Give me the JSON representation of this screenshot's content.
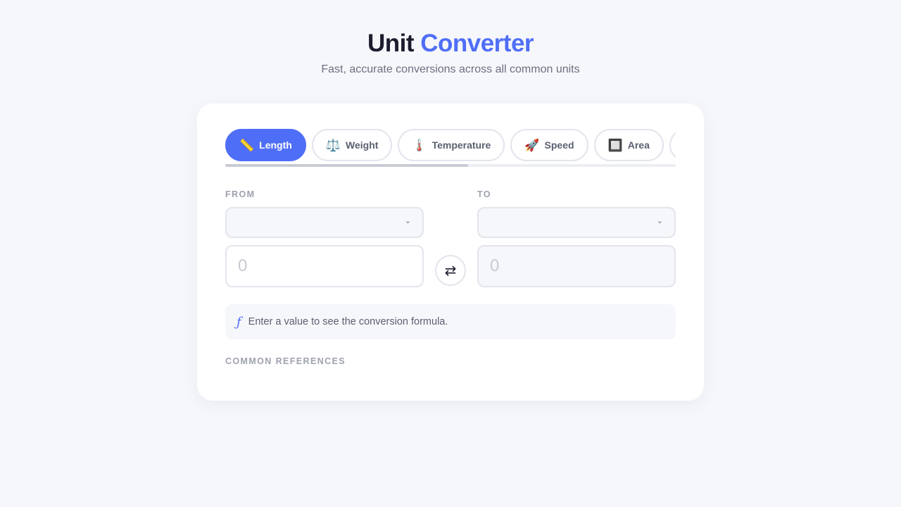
{
  "header": {
    "title_part1": "Unit",
    "title_part2": "Converter",
    "subtitle": "Fast, accurate conversions across all common units"
  },
  "tabs": [
    {
      "label": "Length",
      "icon": "📏",
      "active": true
    },
    {
      "label": "Weight",
      "icon": "⚖️",
      "active": false
    },
    {
      "label": "Temperature",
      "icon": "🌡️",
      "active": false
    },
    {
      "label": "Speed",
      "icon": "🚀",
      "active": false
    },
    {
      "label": "Area",
      "icon": "🔲",
      "active": false
    },
    {
      "label": "",
      "icon": "🧪",
      "active": false
    }
  ],
  "from": {
    "label": "FROM",
    "unit_value": "",
    "input_placeholder": "0"
  },
  "to": {
    "label": "TO",
    "unit_value": "",
    "output_value": "0"
  },
  "swap_icon": "⇄",
  "formula": {
    "icon": "ƒ",
    "text": "Enter a value to see the conversion formula."
  },
  "references": {
    "label": "COMMON REFERENCES"
  }
}
